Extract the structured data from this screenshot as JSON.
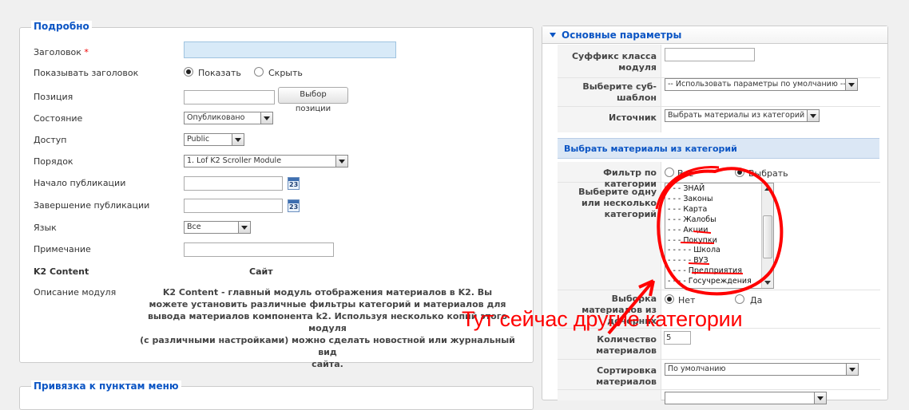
{
  "details": {
    "legend": "Подробно",
    "title_label": "Заголовок",
    "required_mark": "*",
    "show_title_label": "Показывать заголовок",
    "show_option": "Показать",
    "hide_option": "Скрыть",
    "position_label": "Позиция",
    "position_button": "Выбор позиции",
    "state_label": "Состояние",
    "state_value": "Опубликовано",
    "access_label": "Доступ",
    "access_value": "Public",
    "order_label": "Порядок",
    "order_value": "1. Lof K2 Scroller Module",
    "publish_start_label": "Начало публикации",
    "publish_end_label": "Завершение публикации",
    "language_label": "Язык",
    "language_value": "Все",
    "note_label": "Примечание",
    "k2_label": "K2 Content",
    "k2_site": "Сайт",
    "desc_label": "Описание модуля",
    "desc_line1": "K2 Content - главный модуль отображения материалов в K2. Вы",
    "desc_line2": "можете установить различные фильтры категорий и материалов для",
    "desc_line3": "вывода материалов компонента k2. Используя несколько копий этого модуля",
    "desc_line4": "(с различными настройками) можно сделать новостной или журнальный вид",
    "desc_line5": "сайта."
  },
  "menu_binding": {
    "legend": "Привязка к пунктам меню"
  },
  "params": {
    "header": "Основные параметры",
    "suffix_label": "Суффикс класса модуля",
    "subtemplate_label": "Выберите суб-шаблон",
    "subtemplate_value": "-- Использовать параметры по умолчанию --",
    "source_label": "Источник",
    "source_value": "Выбрать материалы из категорий",
    "section_header": "Выбрать материалы из категорий",
    "filter_label": "Фильтр по категории",
    "filter_all": "Все",
    "filter_select": "Выбрать",
    "categories_label": "Выберите одну или несколько категорий",
    "categories": [
      "- - - ЗНАЙ",
      "- - - Законы",
      "- - - Карта",
      "- - - Жалобы",
      "- - - Акции",
      "- - - Покупки",
      "- - - - - Школа",
      "- - - - - ВУЗ",
      "- - - - Предприятия",
      "- - - - Госучреждения"
    ],
    "child_label": "Выборка материалов из дочерних",
    "child_no": "Нет",
    "child_yes": "Да",
    "count_label": "Количество материалов",
    "count_value": "5",
    "sort_label": "Сортировка материалов",
    "sort_value": "По умолчанию"
  },
  "annotation": {
    "text": "Тут сейчас  другие категории",
    "color": "#ff0000"
  },
  "colors": {
    "accent": "#0b55c4",
    "section_bg": "#dbe7f5",
    "title_input_bg": "#d8eaf8"
  }
}
